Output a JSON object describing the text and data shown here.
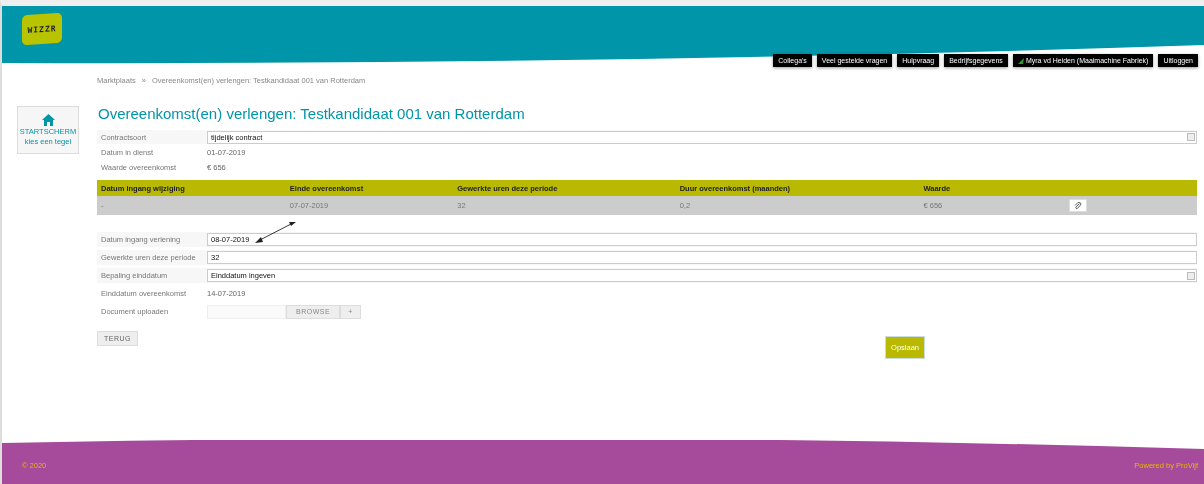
{
  "logo": {
    "text": "WIZZR"
  },
  "nav": [
    {
      "label": "Collega's",
      "status": false
    },
    {
      "label": "Veel gestelde vragen",
      "status": false
    },
    {
      "label": "Hulpvraag",
      "status": false
    },
    {
      "label": "Bedrijfsgegevens",
      "status": false
    },
    {
      "label": "Myra vd Heiden (Maaimachine Fabriek)",
      "status": true
    },
    {
      "label": "Uitloggen",
      "status": false
    }
  ],
  "breadcrumb": [
    "Marktplaats",
    "»",
    "Overeenkomst(en) verlengen: Testkandidaat 001 van Rotterdam"
  ],
  "home_tile": {
    "title": "STARTSCHERM",
    "subtitle": "kies een tegel"
  },
  "title": "Overeenkomst(en) verlengen: Testkandidaat 001 van Rotterdam",
  "contract_fields": [
    {
      "kind": "select",
      "label": "Contractsoort",
      "value": "tijdelijk contract"
    },
    {
      "kind": "static",
      "label": "Datum in dienst",
      "value": "01-07-2019"
    },
    {
      "kind": "static",
      "label": "Waarde overeenkomst",
      "value": "€ 656"
    }
  ],
  "table": {
    "columns": [
      "Datum ingang wijziging",
      "Einde overeenkomst",
      "Gewerkte uren deze periode",
      "Duur overeenkomst (maanden)",
      "Waarde"
    ],
    "rows": [
      [
        "-",
        "07-07-2019",
        "32",
        "0,2",
        "€ 656"
      ]
    ]
  },
  "form_fields": [
    {
      "kind": "text",
      "label": "Datum ingang verlening",
      "value": "08-07-2019"
    },
    {
      "kind": "text",
      "label": "Gewerkte uren deze periode",
      "value": "32"
    },
    {
      "kind": "select",
      "label": "Bepaling einddatum",
      "value": "Einddatum ingeven"
    },
    {
      "kind": "static",
      "label": "Einddatum overeenkomst",
      "value": "14-07-2019"
    },
    {
      "kind": "file",
      "label": "Document uploaden",
      "browse": "BROWSE",
      "add": "+"
    }
  ],
  "back_button": "TERUG",
  "save_button": "Opslaan",
  "footer": {
    "copyright": "© 2020",
    "powered": "Powered by ProVijf"
  }
}
